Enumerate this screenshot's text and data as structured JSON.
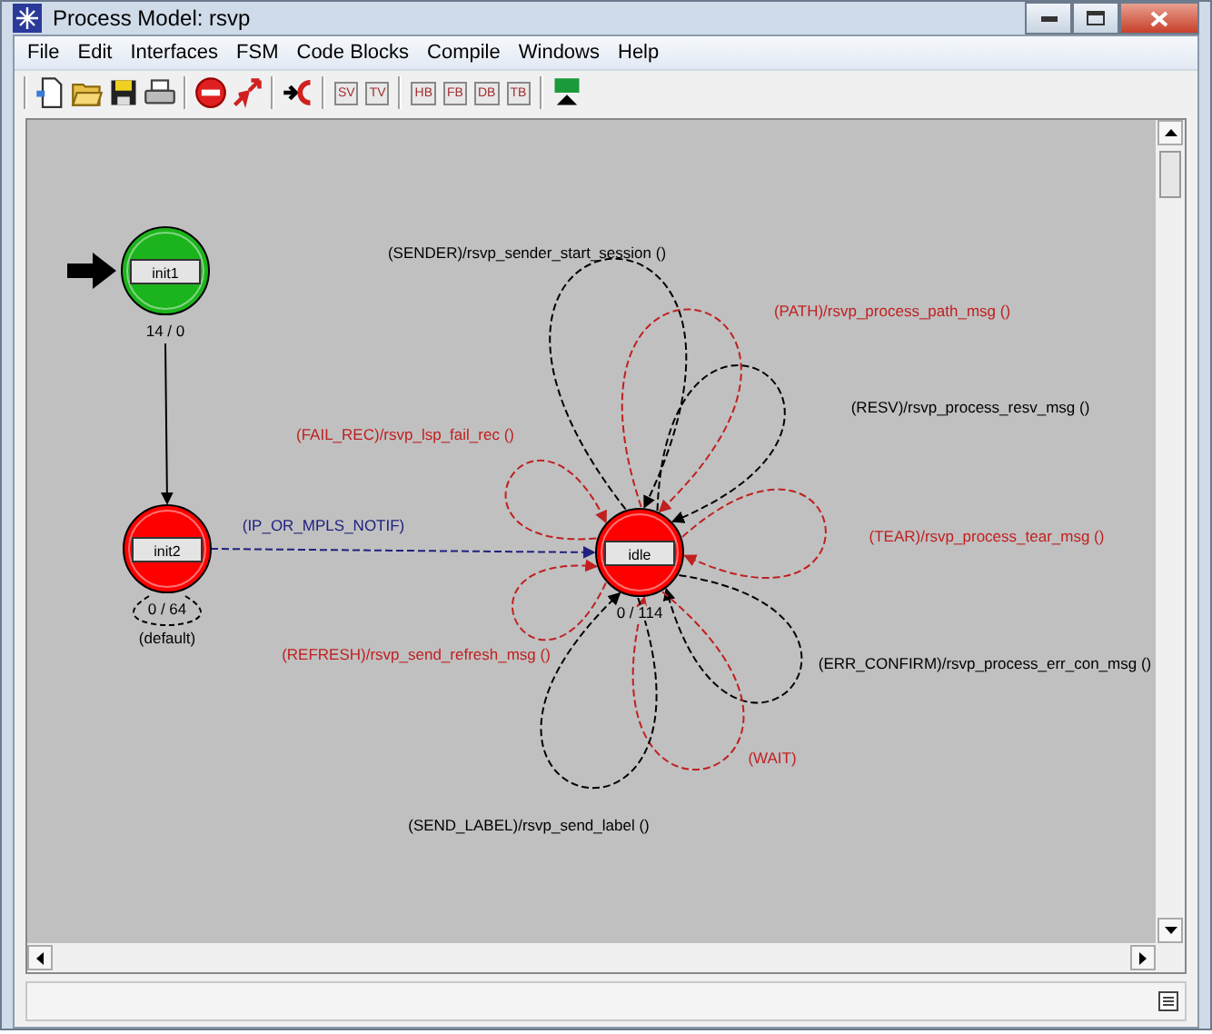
{
  "window": {
    "title": "Process Model: rsvp"
  },
  "menu": [
    "File",
    "Edit",
    "Interfaces",
    "FSM",
    "Code Blocks",
    "Compile",
    "Windows",
    "Help"
  ],
  "toolbar": [
    {
      "kind": "new"
    },
    {
      "kind": "open"
    },
    {
      "kind": "save"
    },
    {
      "kind": "print"
    },
    {
      "kind": "separator"
    },
    {
      "kind": "stop"
    },
    {
      "kind": "compile"
    },
    {
      "kind": "separator"
    },
    {
      "kind": "state"
    },
    {
      "kind": "separator"
    },
    {
      "kind": "text",
      "label": "SV"
    },
    {
      "kind": "text",
      "label": "TV"
    },
    {
      "kind": "separator"
    },
    {
      "kind": "text",
      "label": "HB"
    },
    {
      "kind": "text",
      "label": "FB"
    },
    {
      "kind": "text",
      "label": "DB"
    },
    {
      "kind": "text",
      "label": "TB"
    },
    {
      "kind": "separator"
    },
    {
      "kind": "execute"
    }
  ],
  "states": [
    {
      "name": "init1",
      "counts": "14 / 0",
      "color": "#1cb41c",
      "initial": true
    },
    {
      "name": "init2",
      "counts": "0 / 64",
      "color": "#ff0000",
      "initial": false
    },
    {
      "name": "idle",
      "counts": "0 / 114",
      "color": "#ff0000",
      "initial": false
    }
  ],
  "transitions": [
    {
      "kind": "solid",
      "color": "#000000"
    },
    {
      "kind": "default",
      "label": "(default)",
      "color": "#000000"
    },
    {
      "kind": "straight",
      "label": "(IP_OR_MPLS_NOTIF)",
      "color": "#202080"
    },
    {
      "kind": "loop",
      "label": "(SENDER)/rsvp_sender_start_session ()",
      "color": "#000000"
    },
    {
      "kind": "loop",
      "label": "(PATH)/rsvp_process_path_msg ()",
      "color": "#c02020"
    },
    {
      "kind": "loop",
      "label": "(RESV)/rsvp_process_resv_msg ()",
      "color": "#000000"
    },
    {
      "kind": "loop",
      "label": "(FAIL_REC)/rsvp_lsp_fail_rec ()",
      "color": "#c02020"
    },
    {
      "kind": "loop",
      "label": "(TEAR)/rsvp_process_tear_msg ()",
      "color": "#c02020"
    },
    {
      "kind": "loop",
      "label": "(REFRESH)/rsvp_send_refresh_msg ()",
      "color": "#c02020"
    },
    {
      "kind": "loop",
      "label": "(ERR_CONFIRM)/rsvp_process_err_con_msg ()",
      "color": "#000000"
    },
    {
      "kind": "loop",
      "label": "(WAIT)",
      "color": "#c02020"
    },
    {
      "kind": "loop",
      "label": "(SEND_LABEL)/rsvp_send_label ()",
      "color": "#000000"
    }
  ]
}
